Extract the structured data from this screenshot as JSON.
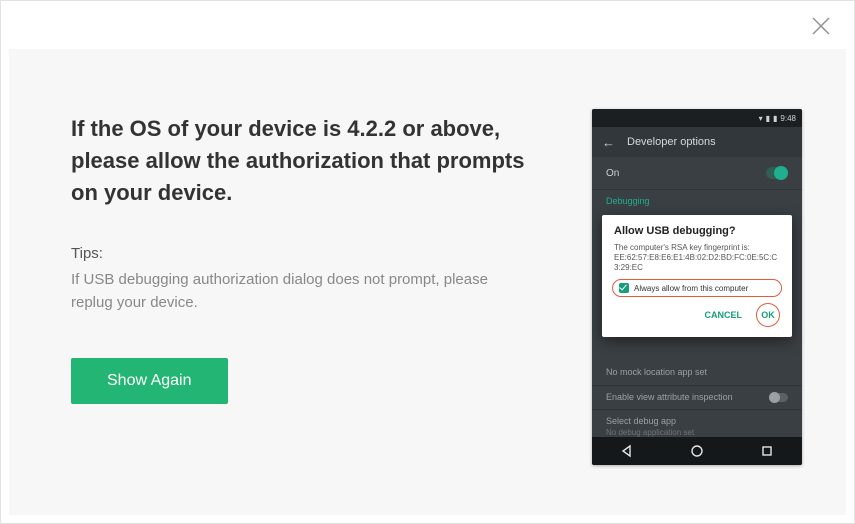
{
  "heading": "If the OS of your device is 4.2.2 or above, please allow the authorization that prompts on your device.",
  "tips_label": "Tips:",
  "tips_body": "If USB debugging authorization dialog does not prompt, please replug your device.",
  "show_again": "Show Again",
  "phone": {
    "time": "9:48",
    "header": "Developer options",
    "on_label": "On",
    "debugging_label": "Debugging",
    "row_no_mock": "No mock location app set",
    "row_enable_view": "Enable view attribute inspection",
    "row_select_debug": "Select debug app",
    "row_select_debug_sub": "No debug application set",
    "dialog": {
      "title": "Allow USB debugging?",
      "fp_lead": "The computer's RSA key fingerprint is:",
      "fp": "EE:62:57:E8:E6:E1:4B:02:D2:BD:FC:0E:5C:C3:29:EC",
      "always": "Always allow from this computer",
      "cancel": "CANCEL",
      "ok": "OK"
    }
  }
}
